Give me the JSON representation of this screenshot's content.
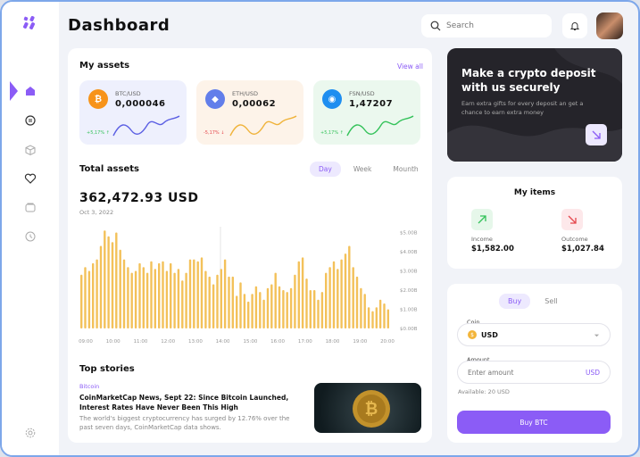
{
  "header": {
    "title": "Dashboard",
    "search_placeholder": "Search"
  },
  "my_assets": {
    "title": "My assets",
    "view_all": "View all",
    "items": [
      {
        "pair": "BTC/USD",
        "value": "0,000046",
        "change": "+5,17%",
        "trend": "up",
        "bg": "#eef0fd",
        "icon_bg": "#f7931a",
        "icon": "bitcoin-icon",
        "line": "#5b5fe3"
      },
      {
        "pair": "ETH/USD",
        "value": "0,00062",
        "change": "-5,17%",
        "trend": "down",
        "bg": "#fdf3e9",
        "icon_bg": "#627eea",
        "icon": "ethereum-icon",
        "line": "#f0b33a"
      },
      {
        "pair": "FSN/USD",
        "value": "1,47207",
        "change": "+5,17%",
        "trend": "up",
        "bg": "#ebf8ee",
        "icon_bg": "#1e8ef0",
        "icon": "fusion-icon",
        "line": "#34c25a"
      }
    ]
  },
  "total_assets": {
    "title": "Total assets",
    "tabs": [
      "Day",
      "Week",
      "Mounth"
    ],
    "active_tab": "Day",
    "amount": "362,472.93 USD",
    "date": "Oct 3, 2022"
  },
  "chart_data": {
    "type": "bar",
    "x_ticks": [
      "09:00",
      "10:00",
      "11:00",
      "12:00",
      "13:00",
      "14:00",
      "15:00",
      "16:00",
      "17:00",
      "18:00",
      "19:00",
      "20:00"
    ],
    "y_ticks": [
      "$5.00B",
      "$4.00B",
      "$3.00B",
      "$2.00B",
      "$1.00B",
      "$0.00B"
    ],
    "ylim": [
      0,
      5.3
    ],
    "values": [
      2.8,
      3.2,
      3.0,
      3.4,
      3.6,
      4.3,
      5.1,
      4.8,
      4.5,
      5.0,
      4.1,
      3.6,
      3.2,
      2.9,
      3.0,
      3.4,
      3.2,
      2.9,
      3.5,
      3.1,
      3.4,
      3.5,
      3.0,
      3.4,
      2.9,
      3.1,
      2.5,
      2.9,
      3.6,
      3.6,
      3.5,
      3.7,
      3.0,
      2.7,
      2.3,
      2.8,
      3.1,
      3.6,
      2.7,
      2.7,
      1.7,
      2.4,
      1.8,
      1.4,
      1.8,
      2.2,
      1.9,
      1.5,
      2.1,
      2.3,
      2.9,
      2.2,
      2.0,
      1.9,
      2.1,
      2.8,
      3.5,
      3.7,
      2.6,
      2.0,
      2.0,
      1.5,
      1.9,
      2.9,
      3.2,
      3.5,
      3.1,
      3.6,
      3.9,
      4.3,
      3.2,
      2.7,
      2.1,
      1.8,
      1.1,
      0.9,
      1.1,
      1.5,
      1.3,
      1.0
    ],
    "bar_color": "#f3c15a",
    "title": "",
    "xlabel": "",
    "ylabel": ""
  },
  "top_stories": {
    "title": "Top stories",
    "tag": "Bitcoin",
    "headline": "CoinMarketCap News, Sept 22: Since Bitcoin Launched, Interest Rates Have Never Been This High",
    "summary": "The world's biggest cryptocurrency has surged by 12.76% over the past seven days, CoinMarketCap data shows."
  },
  "promo": {
    "title": "Make a crypto deposit with us securely",
    "text": "Earn extra gifts for every deposit an get a chance to earn extra money"
  },
  "my_items": {
    "title": "My items",
    "income_label": "Income",
    "income_value": "$1,582.00",
    "outcome_label": "Outcome",
    "outcome_value": "$1,027.84"
  },
  "trade": {
    "tabs": [
      "Buy",
      "Sell"
    ],
    "active_tab": "Buy",
    "coin_label": "Coin",
    "coin_value": "USD",
    "amount_label": "Amount",
    "amount_placeholder": "Enter amount",
    "amount_currency": "USD",
    "available": "Available: 20 USD",
    "button": "Buy BTC"
  },
  "colors": {
    "accent": "#8b5cf6",
    "up": "#34c25a",
    "down": "#e5484d"
  }
}
